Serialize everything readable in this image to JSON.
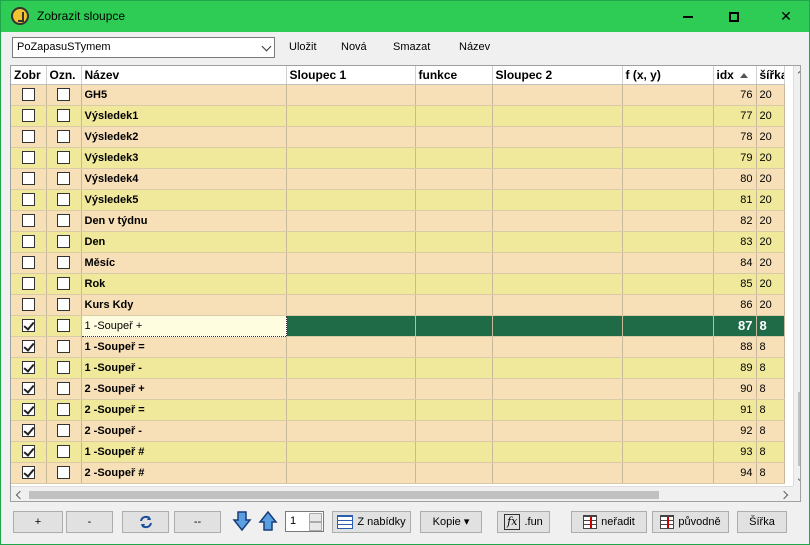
{
  "window": {
    "title": "Zobrazit sloupce"
  },
  "toolbar": {
    "layout_select": "PoZapasuSTymem",
    "save": "Uložit",
    "new": "Nová",
    "delete": "Smazat",
    "name": "Název"
  },
  "grid": {
    "columns": [
      "Zobr",
      "Ozn.",
      "Název",
      "Sloupec 1",
      "funkce",
      "Sloupec 2",
      "f (x, y)",
      "idx",
      "šířka"
    ],
    "rows": [
      {
        "zobr": false,
        "ozn": false,
        "name": "GH5",
        "idx": "76",
        "sirka": "20"
      },
      {
        "zobr": false,
        "ozn": false,
        "name": "Výsledek1",
        "idx": "77",
        "sirka": "20"
      },
      {
        "zobr": false,
        "ozn": false,
        "name": "Výsledek2",
        "idx": "78",
        "sirka": "20"
      },
      {
        "zobr": false,
        "ozn": false,
        "name": "Výsledek3",
        "idx": "79",
        "sirka": "20"
      },
      {
        "zobr": false,
        "ozn": false,
        "name": "Výsledek4",
        "idx": "80",
        "sirka": "20"
      },
      {
        "zobr": false,
        "ozn": false,
        "name": "Výsledek5",
        "idx": "81",
        "sirka": "20"
      },
      {
        "zobr": false,
        "ozn": false,
        "name": "Den v týdnu",
        "idx": "82",
        "sirka": "20"
      },
      {
        "zobr": false,
        "ozn": false,
        "name": "Den",
        "idx": "83",
        "sirka": "20"
      },
      {
        "zobr": false,
        "ozn": false,
        "name": "Měsíc",
        "idx": "84",
        "sirka": "20"
      },
      {
        "zobr": false,
        "ozn": false,
        "name": "Rok",
        "idx": "85",
        "sirka": "20"
      },
      {
        "zobr": false,
        "ozn": false,
        "name": "Kurs Kdy",
        "idx": "86",
        "sirka": "20"
      },
      {
        "zobr": true,
        "ozn": false,
        "name": "1 -Soupeř +",
        "idx": "87",
        "sirka": "8",
        "selected": true
      },
      {
        "zobr": true,
        "ozn": false,
        "name": "1 -Soupeř =",
        "idx": "88",
        "sirka": "8"
      },
      {
        "zobr": true,
        "ozn": false,
        "name": "1 -Soupeř -",
        "idx": "89",
        "sirka": "8"
      },
      {
        "zobr": true,
        "ozn": false,
        "name": "2 -Soupeř +",
        "idx": "90",
        "sirka": "8"
      },
      {
        "zobr": true,
        "ozn": false,
        "name": "2 -Soupeř =",
        "idx": "91",
        "sirka": "8"
      },
      {
        "zobr": true,
        "ozn": false,
        "name": "2 -Soupeř -",
        "idx": "92",
        "sirka": "8"
      },
      {
        "zobr": true,
        "ozn": false,
        "name": "1 -Soupeř #",
        "idx": "93",
        "sirka": "8"
      },
      {
        "zobr": true,
        "ozn": false,
        "name": "2 -Soupeř #",
        "idx": "94",
        "sirka": "8"
      }
    ]
  },
  "bottom": {
    "plus": "+",
    "minus": "-",
    "dashdash": "--",
    "spin_value": "1",
    "z_nabidky": "Z nabídky",
    "kopie": "Kopie",
    "fun": ".fun",
    "neradit": "neřadit",
    "puvodne": "původně",
    "sirka": "Šířka"
  },
  "colors": {
    "titlebar": "#2ecc55",
    "row_odd": "#f7dfb8",
    "row_even": "#f0e89a",
    "selected": "#1f6b48"
  }
}
